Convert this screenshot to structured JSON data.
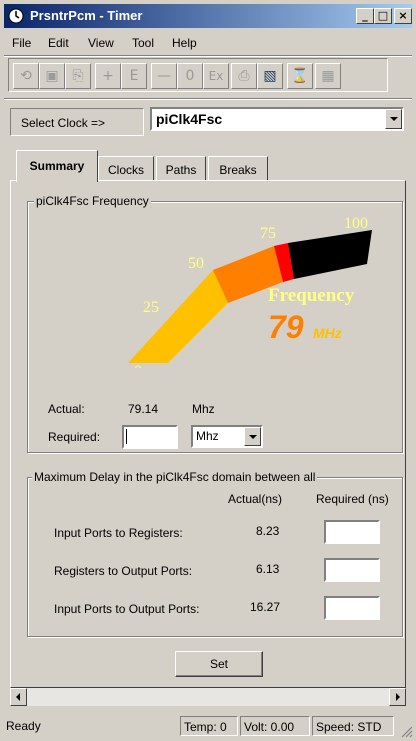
{
  "window": {
    "title": "PrsntrPcm - Timer"
  },
  "menu": [
    "File",
    "Edit",
    "View",
    "Tool",
    "Help"
  ],
  "toolbar_icons": [
    "refresh-icon",
    "save-icon",
    "copy-icon",
    "plus-icon",
    "e-icon",
    "minus-icon",
    "zero-icon",
    "ex-icon",
    "print-icon",
    "report-icon",
    "hourglass-icon",
    "grid-icon"
  ],
  "toolbar_glyphs": [
    "⟲",
    "▣",
    "⎘",
    "+",
    "E",
    "—",
    "0",
    "Ex",
    "⎙",
    "▧",
    "⌛",
    "▦"
  ],
  "clock": {
    "label": "Select Clock =>",
    "value": "piClk4Fsc"
  },
  "tabs": [
    "Summary",
    "Clocks",
    "Paths",
    "Breaks"
  ],
  "frequency_group": {
    "title": "piClk4Fsc Frequency",
    "gauge": {
      "ticks": [
        "0",
        "25",
        "50",
        "75",
        "100"
      ],
      "caption": "Frequency",
      "value": "79",
      "unit": "MHz",
      "level": 79,
      "colors": {
        "low": "#ffc000",
        "mid": "#ff8000",
        "high": "#ff0000",
        "rest": "#000000",
        "text": "#ffff80"
      }
    },
    "actual_label": "Actual:",
    "actual_value": "79.14",
    "actual_unit": "Mhz",
    "required_label": "Required:",
    "required_value": "",
    "required_unit": "Mhz"
  },
  "delay_group": {
    "title": "Maximum Delay in the piClk4Fsc domain between all",
    "col_actual": "Actual(ns)",
    "col_required": "Required (ns)",
    "rows": [
      {
        "label": "Input Ports to Registers:",
        "actual": "8.23",
        "required": ""
      },
      {
        "label": "Registers to Output Ports:",
        "actual": "6.13",
        "required": ""
      },
      {
        "label": "Input Ports to Output Ports:",
        "actual": "16.27",
        "required": ""
      }
    ]
  },
  "set_button": "Set",
  "status": {
    "text": "Ready",
    "temp": "Temp: 0",
    "volt": "Volt: 0.00",
    "speed": "Speed: STD"
  }
}
